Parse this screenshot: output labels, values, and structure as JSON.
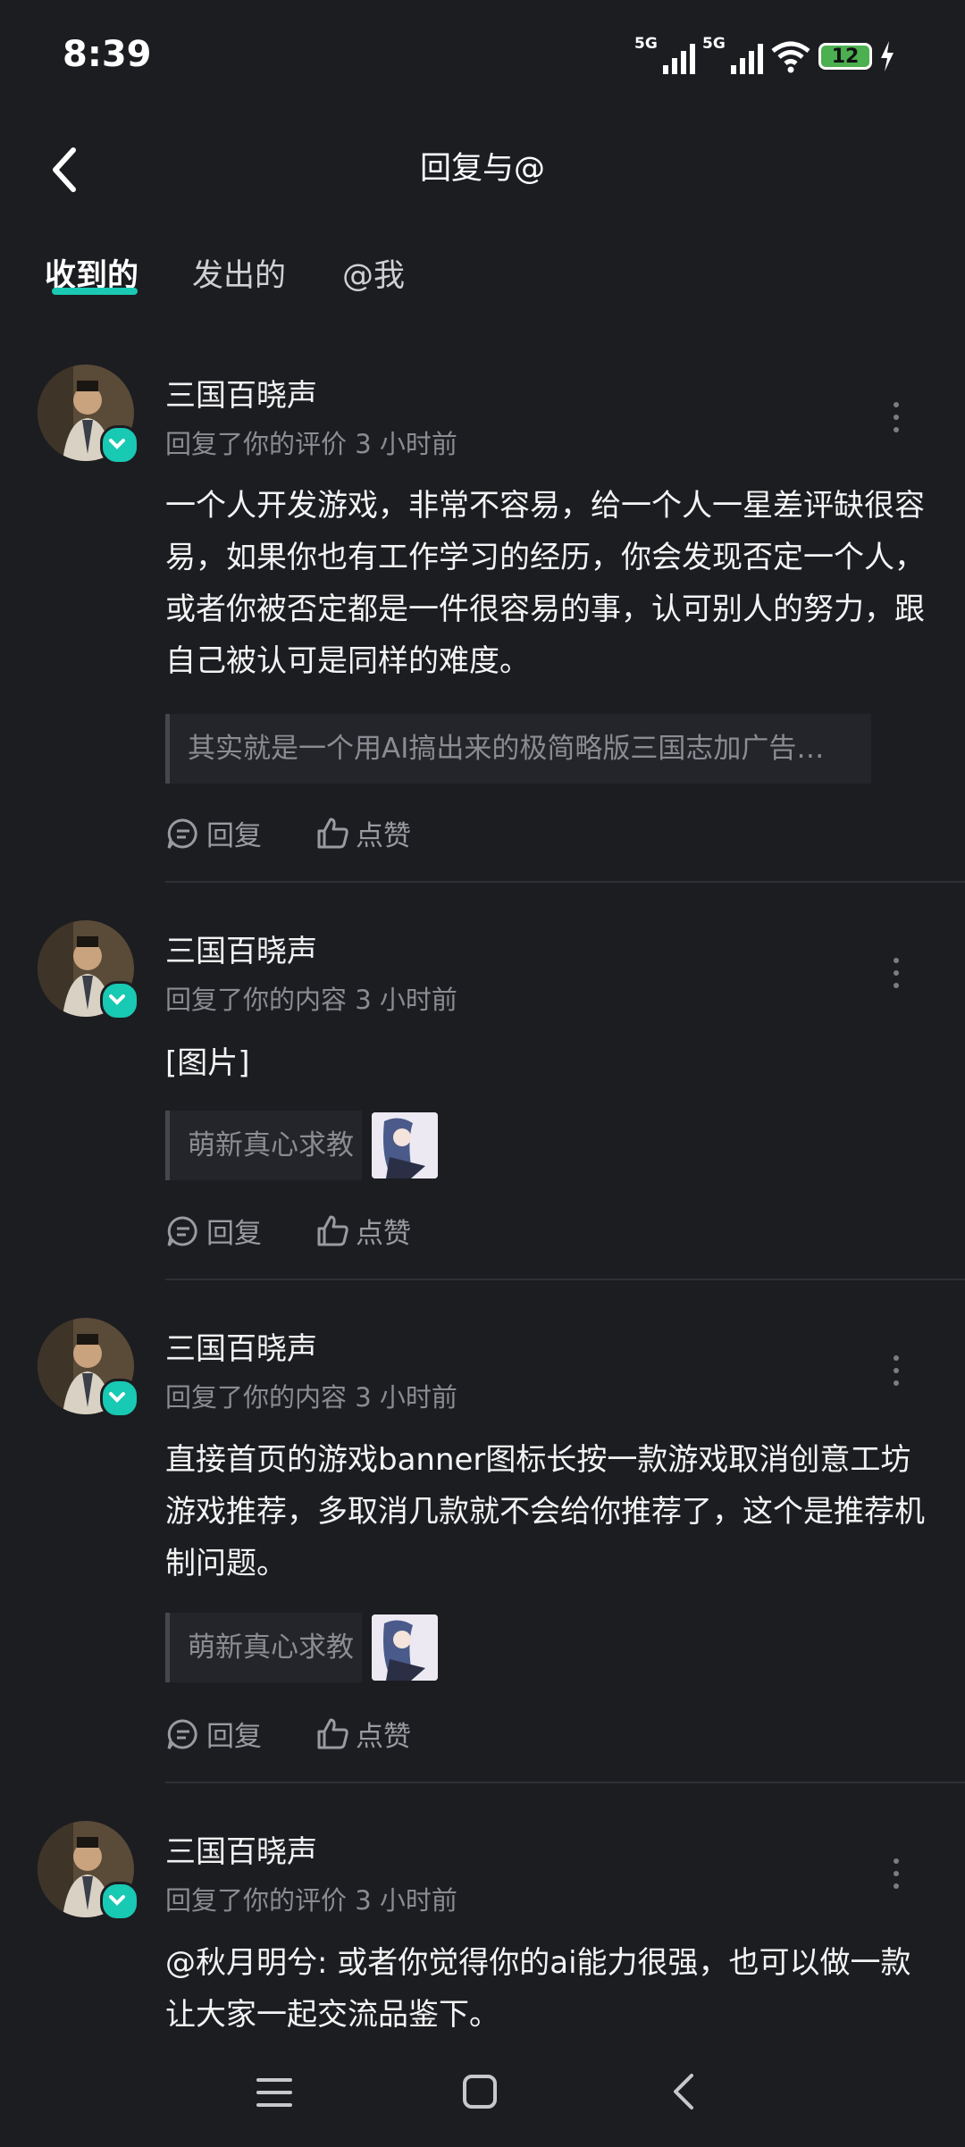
{
  "status": {
    "time": "8:39",
    "signal1_label": "5G",
    "signal2_label": "5G",
    "battery": "12"
  },
  "header": {
    "title": "回复与@"
  },
  "tabs": [
    {
      "label": "收到的",
      "active": true
    },
    {
      "label": "发出的",
      "active": false
    },
    {
      "label": "@我",
      "active": false
    }
  ],
  "items": [
    {
      "user": "三国百晓声",
      "meta": "回复了你的评价 3 小时前",
      "body": "一个人开发游戏，非常不容易，给一个人一星差评缺很容易，如果你也有工作学习的经历，你会发现否定一个人，或者你被否定都是一件很容易的事，认可别人的努力，跟自己被认可是同样的难度。",
      "quote": "其实就是一个用AI搞出来的极简略版三国志加广告…",
      "reply": "回复",
      "like": "点赞"
    },
    {
      "user": "三国百晓声",
      "meta": "回复了你的内容 3 小时前",
      "body": "[图片]",
      "quote": "萌新真心求教",
      "reply": "回复",
      "like": "点赞"
    },
    {
      "user": "三国百晓声",
      "meta": "回复了你的内容 3 小时前",
      "body": "直接首页的游戏banner图标长按一款游戏取消创意工坊游戏推荐，多取消几款就不会给你推荐了，这个是推荐机制问题。",
      "quote": "萌新真心求教",
      "reply": "回复",
      "like": "点赞"
    },
    {
      "user": "三国百晓声",
      "meta": "回复了你的评价 3 小时前",
      "body": "@秋月明兮: 或者你觉得你的ai能力很强，也可以做一款让大家一起交流品鉴下。"
    }
  ],
  "colors": {
    "background": "#1c1d21",
    "accent": "#19c9b3",
    "secondary_text": "#8b8c92"
  },
  "icons": [
    "back-arrow-icon",
    "more-icon",
    "reply-icon",
    "like-icon",
    "verified-icon",
    "menu-icon",
    "home-icon",
    "nav-back-icon"
  ]
}
